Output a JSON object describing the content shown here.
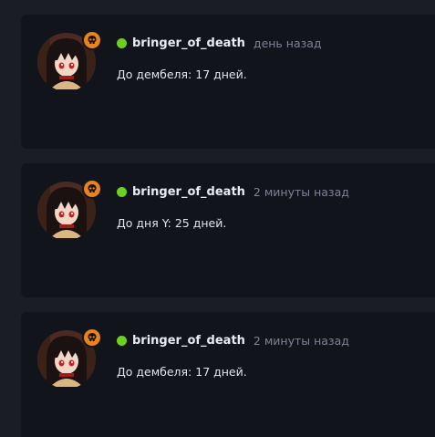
{
  "posts": [
    {
      "username": "bringer_of_death",
      "time": "день назад",
      "message": "До дембеля: 17 дней.",
      "avatar_icon": "anime-girl-avatar",
      "badge_icon": "skull-icon",
      "status_color": "#6fcf1f",
      "badge_color": "#e8831e"
    },
    {
      "username": "bringer_of_death",
      "time": "2 минуты назад",
      "message": "До дня Y: 25 дней.",
      "avatar_icon": "anime-girl-avatar",
      "badge_icon": "skull-icon",
      "status_color": "#6fcf1f",
      "badge_color": "#e8831e"
    },
    {
      "username": "bringer_of_death",
      "time": "2 минуты назад",
      "message": "До дембеля: 17 дней.",
      "avatar_icon": "anime-girl-avatar",
      "badge_icon": "skull-icon",
      "status_color": "#6fcf1f",
      "badge_color": "#e8831e"
    }
  ],
  "colors": {
    "page_background": "#1b1d26",
    "card_background": "#12141c",
    "username": "#e9ebf1",
    "timestamp": "#7d8294",
    "message": "#e2e4ea"
  }
}
